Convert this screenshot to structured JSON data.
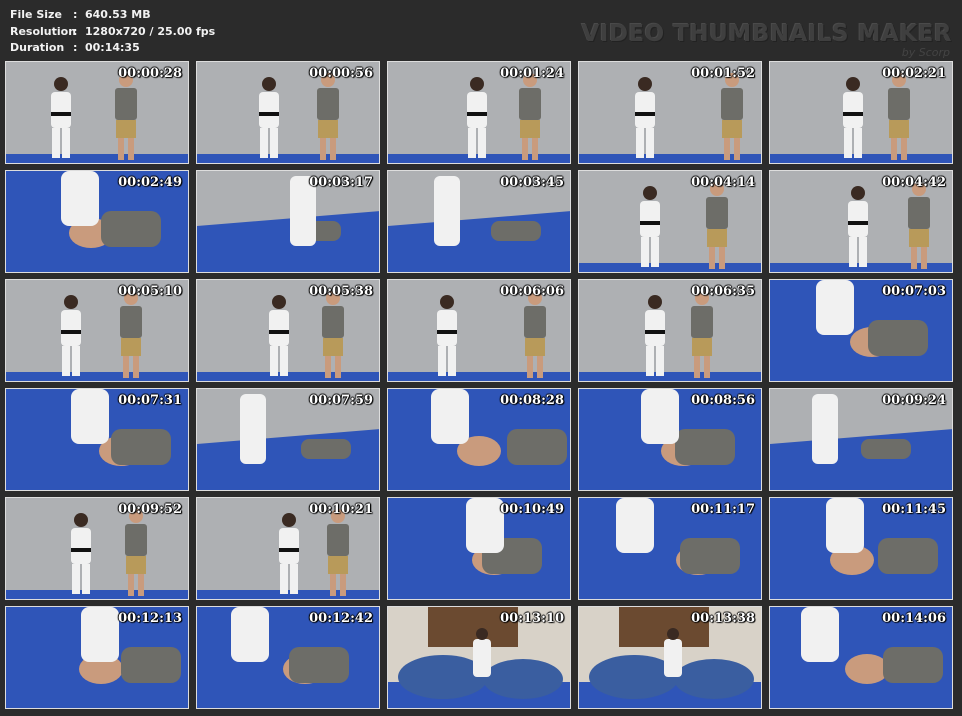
{
  "info": {
    "file_size_label": "File Size",
    "file_size_value": "640.53 MB",
    "resolution_label": "Resolution",
    "resolution_value": "1280x720 / 25.00 fps",
    "duration_label": "Duration",
    "duration_value": "00:14:35",
    "separator": ":"
  },
  "watermark": {
    "title": "VIDEO THUMBNAILS MAKER",
    "subtitle": "by Scorp"
  },
  "thumbnails": [
    {
      "time": "00:00:28",
      "scene": "wall"
    },
    {
      "time": "00:00:56",
      "scene": "wall"
    },
    {
      "time": "00:01:24",
      "scene": "wall"
    },
    {
      "time": "00:01:52",
      "scene": "wall"
    },
    {
      "time": "00:02:21",
      "scene": "wall"
    },
    {
      "time": "00:02:49",
      "scene": "floor"
    },
    {
      "time": "00:03:17",
      "scene": "mixed"
    },
    {
      "time": "00:03:45",
      "scene": "mixed"
    },
    {
      "time": "00:04:14",
      "scene": "wall"
    },
    {
      "time": "00:04:42",
      "scene": "wall"
    },
    {
      "time": "00:05:10",
      "scene": "wall"
    },
    {
      "time": "00:05:38",
      "scene": "wall"
    },
    {
      "time": "00:06:06",
      "scene": "wall"
    },
    {
      "time": "00:06:35",
      "scene": "wall"
    },
    {
      "time": "00:07:03",
      "scene": "floor"
    },
    {
      "time": "00:07:31",
      "scene": "floor"
    },
    {
      "time": "00:07:59",
      "scene": "mixed"
    },
    {
      "time": "00:08:28",
      "scene": "floor"
    },
    {
      "time": "00:08:56",
      "scene": "floor"
    },
    {
      "time": "00:09:24",
      "scene": "mixed"
    },
    {
      "time": "00:09:52",
      "scene": "wall"
    },
    {
      "time": "00:10:21",
      "scene": "wall"
    },
    {
      "time": "00:10:49",
      "scene": "floor"
    },
    {
      "time": "00:11:17",
      "scene": "floor"
    },
    {
      "time": "00:11:45",
      "scene": "floor"
    },
    {
      "time": "00:12:13",
      "scene": "floor"
    },
    {
      "time": "00:12:42",
      "scene": "floor"
    },
    {
      "time": "00:13:10",
      "scene": "room"
    },
    {
      "time": "00:13:38",
      "scene": "room"
    },
    {
      "time": "00:14:06",
      "scene": "floor"
    }
  ],
  "colors": {
    "background": "#2b2b2b",
    "mat_blue": "#2f55b8",
    "wall_gray": "#aeb0b3",
    "gi_white": "#f1f1f1",
    "shirt_gray": "#6d6d68",
    "shorts_khaki": "#b89a5a"
  }
}
